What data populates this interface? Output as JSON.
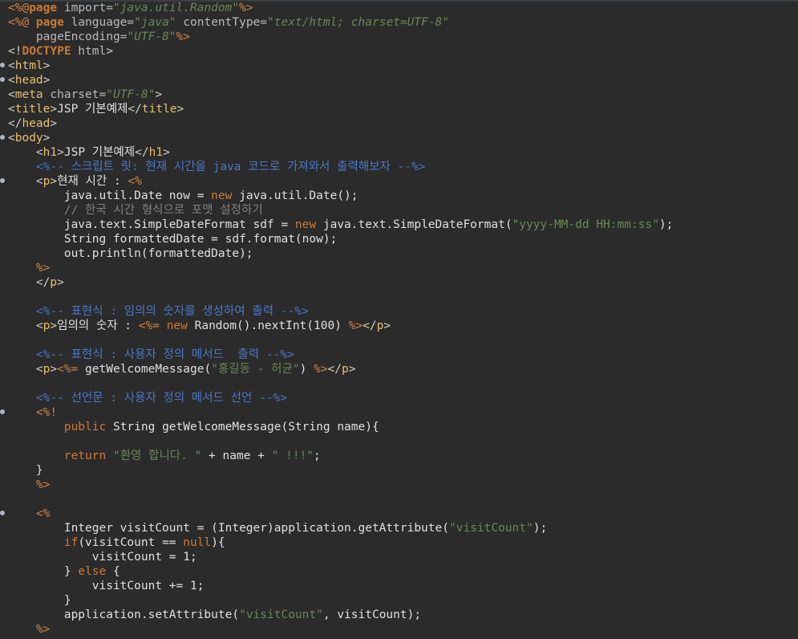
{
  "editor": {
    "lines": [
      [
        [
          "<%@",
          "d"
        ],
        [
          "page",
          "k"
        ],
        [
          " import=",
          "a"
        ],
        [
          "\"java.util.Random\"",
          "av"
        ],
        [
          "%>",
          "d"
        ]
      ],
      [
        [
          "<%@ ",
          "d"
        ],
        [
          "page",
          "k"
        ],
        [
          " language=",
          "a"
        ],
        [
          "\"java\"",
          "av"
        ],
        [
          " contentType=",
          "a"
        ],
        [
          "\"text/html; charset=UTF-8\"",
          "av"
        ]
      ],
      [
        [
          "    pageEncoding=",
          "a"
        ],
        [
          "\"UTF-8\"",
          "av"
        ],
        [
          "%>",
          "d"
        ]
      ],
      [
        [
          "<!",
          "b"
        ],
        [
          "DOCTYPE",
          "k"
        ],
        [
          " html",
          "a"
        ],
        [
          ">",
          "b"
        ]
      ],
      [
        [
          "<",
          "b"
        ],
        [
          "html",
          "t"
        ],
        [
          ">",
          "b"
        ]
      ],
      [
        [
          "<",
          "b"
        ],
        [
          "head",
          "t"
        ],
        [
          ">",
          "b"
        ]
      ],
      [
        [
          "<",
          "b"
        ],
        [
          "meta",
          "t"
        ],
        [
          " charset=",
          "a"
        ],
        [
          "\"UTF-8\"",
          "av"
        ],
        [
          ">",
          "b"
        ]
      ],
      [
        [
          "<",
          "b"
        ],
        [
          "title",
          "t"
        ],
        [
          ">",
          "b"
        ],
        [
          "JSP 기본예제",
          "tx"
        ],
        [
          "</",
          "b"
        ],
        [
          "title",
          "t"
        ],
        [
          ">",
          "b"
        ]
      ],
      [
        [
          "</",
          "b"
        ],
        [
          "head",
          "t"
        ],
        [
          ">",
          "b"
        ]
      ],
      [
        [
          "<",
          "b"
        ],
        [
          "body",
          "t"
        ],
        [
          ">",
          "b"
        ]
      ],
      [
        [
          "    <",
          "b"
        ],
        [
          "h1",
          "t"
        ],
        [
          ">",
          "b"
        ],
        [
          "JSP 기본예제",
          "tx"
        ],
        [
          "</",
          "b"
        ],
        [
          "h1",
          "t"
        ],
        [
          ">",
          "b"
        ]
      ],
      [
        [
          "    <%-- 스크립트 릿: 현재 시간을 java 코드로 가져와서 출력해보자 --%>",
          "hc"
        ]
      ],
      [
        [
          "    <",
          "b"
        ],
        [
          "p",
          "t"
        ],
        [
          ">",
          "b"
        ],
        [
          "현재 시간 : ",
          "tx"
        ],
        [
          "<%",
          "d"
        ]
      ],
      [
        [
          "        java.util.Date now = ",
          "tx"
        ],
        [
          "new",
          "jk"
        ],
        [
          " java.util.Date();",
          "tx"
        ]
      ],
      [
        [
          "        // 한국 시간 형식으로 포맷 설정하기",
          "jc"
        ]
      ],
      [
        [
          "        java.text.SimpleDateFormat sdf = ",
          "tx"
        ],
        [
          "new",
          "jk"
        ],
        [
          " java.text.SimpleDateFormat(",
          "tx"
        ],
        [
          "\"yyyy-MM-dd HH:mm:ss\"",
          "js"
        ],
        [
          ");",
          "tx"
        ]
      ],
      [
        [
          "        String formattedDate = sdf.format(now);",
          "tx"
        ]
      ],
      [
        [
          "        out.println(formattedDate);",
          "tx"
        ]
      ],
      [
        [
          "    %>",
          "d"
        ]
      ],
      [
        [
          "    </",
          "b"
        ],
        [
          "p",
          "t"
        ],
        [
          ">",
          "b"
        ]
      ],
      [
        [
          "",
          "tx"
        ]
      ],
      [
        [
          "    <%-- 표현식 : 임의의 숫자를 생성하여 출력 --%>",
          "hc"
        ]
      ],
      [
        [
          "    <",
          "b"
        ],
        [
          "p",
          "t"
        ],
        [
          ">",
          "b"
        ],
        [
          "임의의 숫자 : ",
          "tx"
        ],
        [
          "<%=",
          "d"
        ],
        [
          " ",
          "tx"
        ],
        [
          "new",
          "jk"
        ],
        [
          " Random().nextInt(100) ",
          "tx"
        ],
        [
          "%>",
          "d"
        ],
        [
          "</",
          "b"
        ],
        [
          "p",
          "t"
        ],
        [
          ">",
          "b"
        ]
      ],
      [
        [
          "",
          "tx"
        ]
      ],
      [
        [
          "    <%-- 표현식 : 사용자 정의 메서드  출력 --%>",
          "hc"
        ]
      ],
      [
        [
          "    <",
          "b"
        ],
        [
          "p",
          "t"
        ],
        [
          ">",
          "b"
        ],
        [
          "<%=",
          "d"
        ],
        [
          " getWelcomeMessage(",
          "tx"
        ],
        [
          "\"홍길동 - 허균\"",
          "js"
        ],
        [
          ") ",
          "tx"
        ],
        [
          "%>",
          "d"
        ],
        [
          "</",
          "b"
        ],
        [
          "p",
          "t"
        ],
        [
          ">",
          "b"
        ]
      ],
      [
        [
          "",
          "tx"
        ]
      ],
      [
        [
          "    <%-- 선언문 : 사용자 정의 메서드 선언 --%>",
          "hc"
        ]
      ],
      [
        [
          "    <%!",
          "d"
        ]
      ],
      [
        [
          "        ",
          "tx"
        ],
        [
          "public",
          "jk"
        ],
        [
          " String getWelcomeMessage(String name){",
          "tx"
        ]
      ],
      [
        [
          "",
          "tx"
        ]
      ],
      [
        [
          "        ",
          "tx"
        ],
        [
          "return",
          "jk"
        ],
        [
          " ",
          "tx"
        ],
        [
          "\"환영 합니다. \"",
          "js"
        ],
        [
          " + name + ",
          "tx"
        ],
        [
          "\" !!!\"",
          "js"
        ],
        [
          ";",
          "tx"
        ]
      ],
      [
        [
          "    }",
          "tx"
        ]
      ],
      [
        [
          "    %>",
          "d"
        ]
      ],
      [
        [
          "",
          "tx"
        ]
      ],
      [
        [
          "    <%",
          "d"
        ]
      ],
      [
        [
          "        Integer visitCount = (Integer)application.getAttribute(",
          "tx"
        ],
        [
          "\"visitCount\"",
          "js"
        ],
        [
          ");",
          "tx"
        ]
      ],
      [
        [
          "        ",
          "tx"
        ],
        [
          "if",
          "jk"
        ],
        [
          "(visitCount == ",
          "tx"
        ],
        [
          "null",
          "jk"
        ],
        [
          "){",
          "tx"
        ]
      ],
      [
        [
          "            visitCount = 1;",
          "tx"
        ]
      ],
      [
        [
          "        } ",
          "tx"
        ],
        [
          "else",
          "jk"
        ],
        [
          " {",
          "tx"
        ]
      ],
      [
        [
          "            visitCount += 1;",
          "tx"
        ]
      ],
      [
        [
          "        }",
          "tx"
        ]
      ],
      [
        [
          "        application.setAttribute(",
          "tx"
        ],
        [
          "\"visitCount\"",
          "js"
        ],
        [
          ", visitCount);",
          "tx"
        ]
      ],
      [
        [
          "    %>",
          "d"
        ]
      ]
    ]
  }
}
